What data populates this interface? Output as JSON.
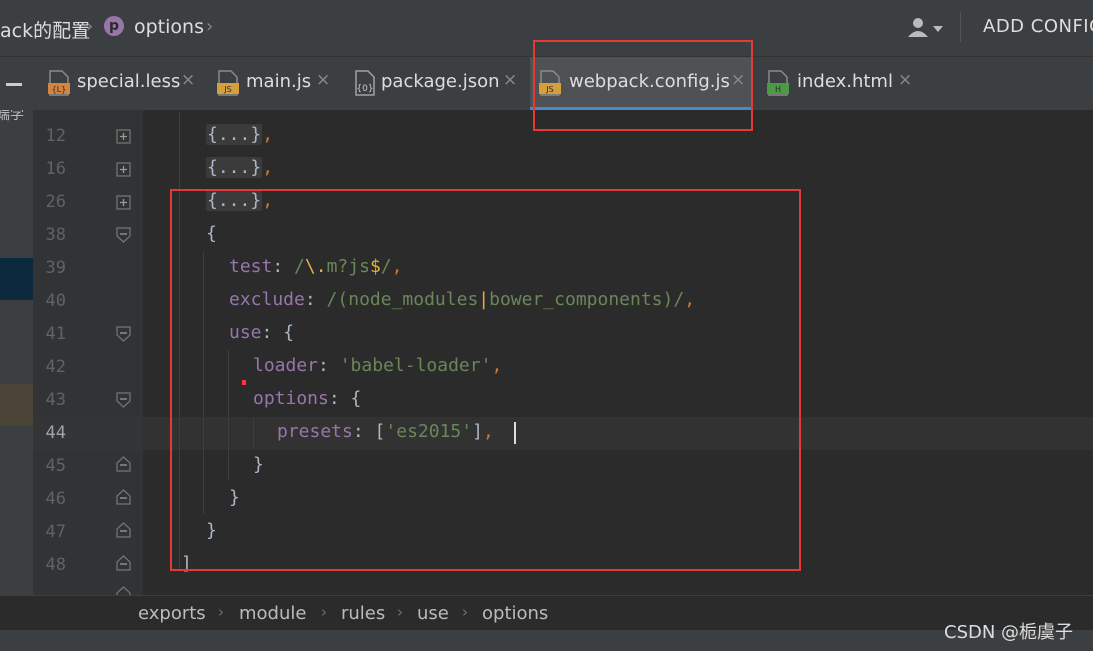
{
  "breadcrumb": {
    "first": "ack的配置",
    "second_icon_letter": "p",
    "second": "options",
    "separator": "›"
  },
  "toolbar": {
    "add_config_label": "ADD CONFIG"
  },
  "tabs": [
    {
      "label": "special.less",
      "icon": "less-file-icon",
      "icon_text": "{L}",
      "icon_color": "#d4843e"
    },
    {
      "label": "main.js",
      "icon": "js-file-icon",
      "icon_text": "JS",
      "icon_color": "#d4a03e"
    },
    {
      "label": "package.json",
      "icon": "json-file-icon",
      "icon_text": "{0}",
      "icon_color": "#a0a0a0"
    },
    {
      "label": "webpack.config.js",
      "icon": "js-file-icon",
      "icon_text": "JS",
      "icon_color": "#d4a03e",
      "active": true
    },
    {
      "label": "index.html",
      "icon": "html-file-icon",
      "icon_text": "H",
      "icon_color": "#4b9b44"
    }
  ],
  "tab_close_glyph": "×",
  "sidebar": {
    "cut_text": "端学"
  },
  "editor": {
    "line_numbers": [
      "12",
      "16",
      "26",
      "38",
      "39",
      "40",
      "41",
      "42",
      "43",
      "44",
      "45",
      "46",
      "47",
      "48"
    ],
    "current_line": "44",
    "lines": {
      "l12": "{...}",
      "l16": "{...}",
      "l26": "{...}",
      "comma": ",",
      "l38": "{",
      "l39_key": "test",
      "l39_colon": ": ",
      "l39_re_a": "/",
      "l39_re_b": "\\.",
      "l39_re_c": "m?js",
      "l39_re_d": "$",
      "l39_re_e": "/",
      "l40_key": "exclude",
      "l40_colon": ": ",
      "l40_re_a": "/(",
      "l40_re_b": "node_modules",
      "l40_re_c": "|",
      "l40_re_d": "bower_components",
      "l40_re_e": ")/",
      "l41_key": "use",
      "l41_rest": ": {",
      "l42_key": "loader",
      "l42_colon": ": ",
      "l42_val": "'babel-loader'",
      "l43_key": "options",
      "l43_rest": ": {",
      "l44_key": "presets",
      "l44_colon": ": ",
      "l44_open": "[",
      "l44_val": "'es2015'",
      "l44_close": "]",
      "l45": "}",
      "l46": "}",
      "l47": "}",
      "l48": "]"
    }
  },
  "bottom_breadcrumb": [
    "exports",
    "module",
    "rules",
    "use",
    "options"
  ],
  "watermark": "CSDN @栀虞子",
  "colors": {
    "annotation_red": "#e53935",
    "keyword_purple": "#9876aa",
    "string_green": "#6a8759",
    "punct_orange": "#cc7832"
  }
}
